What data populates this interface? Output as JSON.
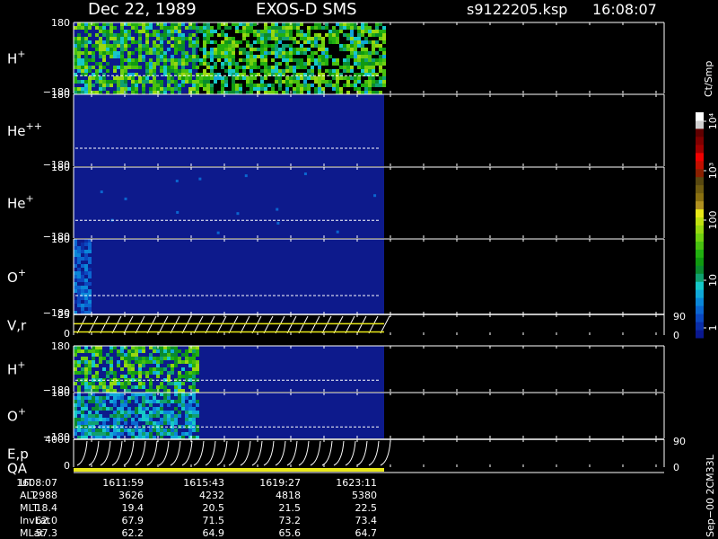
{
  "header": {
    "date": "Dec 22, 1989",
    "instrument": "EXOS-D SMS",
    "file": "s9122205.ksp",
    "time": "16:08:07"
  },
  "chart_data": {
    "type": "heatmap",
    "panels": [
      {
        "name": "H+",
        "label_base": "H",
        "label_sup": "+",
        "ylim": [
          -180,
          180
        ],
        "tick_top": "180",
        "tick_bottom": "−180",
        "data_end_fraction": 0.4,
        "active_fraction": 1.0,
        "intensity": "high"
      },
      {
        "name": "He++",
        "label_base": "He",
        "label_sup": "++",
        "ylim": [
          -180,
          180
        ],
        "tick_top": "180",
        "tick_bottom": "−180",
        "data_end_fraction": 1.0,
        "active_fraction": 0.0,
        "intensity": "none"
      },
      {
        "name": "He+",
        "label_base": "He",
        "label_sup": "+",
        "ylim": [
          -180,
          180
        ],
        "tick_top": "180",
        "tick_bottom": "−180",
        "data_end_fraction": 1.0,
        "active_fraction": 0.0,
        "intensity": "sparse"
      },
      {
        "name": "O+",
        "label_base": "O",
        "label_sup": "+",
        "ylim": [
          -180,
          180
        ],
        "tick_top": "180",
        "tick_bottom": "−180",
        "data_end_fraction": 1.0,
        "active_fraction": 0.05,
        "intensity": "low"
      },
      {
        "name": "V,r",
        "label_base": "V,r",
        "label_sup": "",
        "ylim": [
          0,
          25
        ],
        "tick_top": "25",
        "tick_bottom": "0",
        "right_top": "90",
        "right_bottom": "0",
        "type": "line"
      },
      {
        "name": "H+",
        "label_base": "H",
        "label_sup": "+",
        "ylim": [
          -180,
          180
        ],
        "tick_top": "180",
        "tick_bottom": "−180",
        "data_end_fraction": 1.0,
        "active_fraction": 0.4,
        "intensity": "high"
      },
      {
        "name": "O+",
        "label_base": "O",
        "label_sup": "+",
        "ylim": [
          -180,
          180
        ],
        "tick_top": "180",
        "tick_bottom": "−180",
        "data_end_fraction": 1.0,
        "active_fraction": 0.4,
        "intensity": "medium"
      },
      {
        "name": "E,p QA",
        "label_base": "E,p",
        "label2": "QA",
        "label_sup": "",
        "ylim": [
          0,
          4000
        ],
        "tick_top": "4000",
        "tick_bottom": "0",
        "right_top": "90",
        "right_bottom": "0",
        "type": "line"
      }
    ],
    "colorbar": {
      "unit": "Ct/Smp",
      "ticks": [
        "1",
        "10",
        "100",
        "10³",
        "10⁴"
      ],
      "colors": [
        "#0a1890",
        "#0a2ea8",
        "#0b48c0",
        "#0b66d0",
        "#0a86d8",
        "#10a8d8",
        "#16c8c8",
        "#10a070",
        "#0a8a30",
        "#109a10",
        "#22b010",
        "#48c010",
        "#70d010",
        "#98d810",
        "#c0e010",
        "#e8e818",
        "#b09020",
        "#8a7010",
        "#705c10",
        "#584810",
        "#8a2000",
        "#c01000",
        "#f00000",
        "#a00000",
        "#800000",
        "#600000",
        "#d0d0d0",
        "#ffffff"
      ]
    },
    "time_axis": {
      "labels": [
        "1608:07",
        "1611:59",
        "1615:43",
        "1619:27",
        "1623:11"
      ],
      "rows": [
        {
          "name": "UT",
          "values": [
            "1608:07",
            "1611:59",
            "1615:43",
            "1619:27",
            "1623:11"
          ]
        },
        {
          "name": "ALT",
          "values": [
            "2988",
            "3626",
            "4232",
            "4818",
            "5380"
          ]
        },
        {
          "name": "MLT",
          "values": [
            "18.4",
            "19.4",
            "20.5",
            "21.5",
            "22.5"
          ]
        },
        {
          "name": "InvLat",
          "values": [
            "62.0",
            "67.9",
            "71.5",
            "73.2",
            "73.4"
          ]
        },
        {
          "name": "MLat",
          "values": [
            "57.3",
            "62.2",
            "64.9",
            "65.6",
            "64.7"
          ]
        }
      ]
    }
  },
  "footer": {
    "id": "Sep−00 2CM33L"
  }
}
